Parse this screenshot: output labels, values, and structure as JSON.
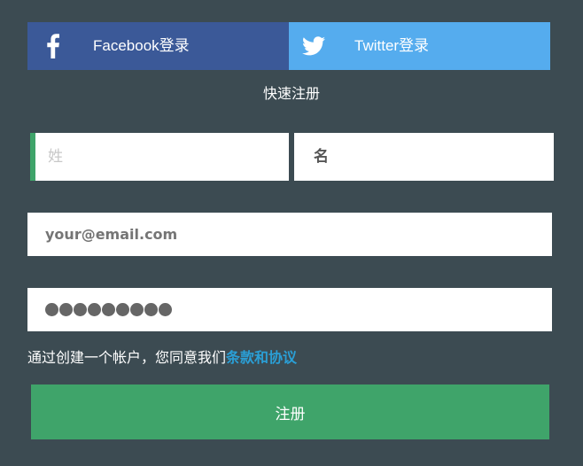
{
  "social": {
    "facebook": {
      "label": "Facebook登录",
      "icon": "facebook-icon",
      "color": "#3b5998"
    },
    "twitter": {
      "label": "Twitter登录",
      "icon": "twitter-icon",
      "color": "#55acee"
    }
  },
  "form": {
    "heading": "快速注册",
    "last_name": {
      "placeholder": "姓",
      "value": ""
    },
    "first_name": {
      "placeholder": "名",
      "value": ""
    },
    "email": {
      "placeholder": "your@email.com",
      "value": ""
    },
    "password": {
      "masked_length": 9
    },
    "terms_prefix": "通过创建一个帐户，您同意我们",
    "terms_link": "条款和协议",
    "submit_label": "注册"
  },
  "colors": {
    "background": "#3c4b52",
    "accent_green": "#3fa46a",
    "link_blue": "#2a9fd6"
  }
}
